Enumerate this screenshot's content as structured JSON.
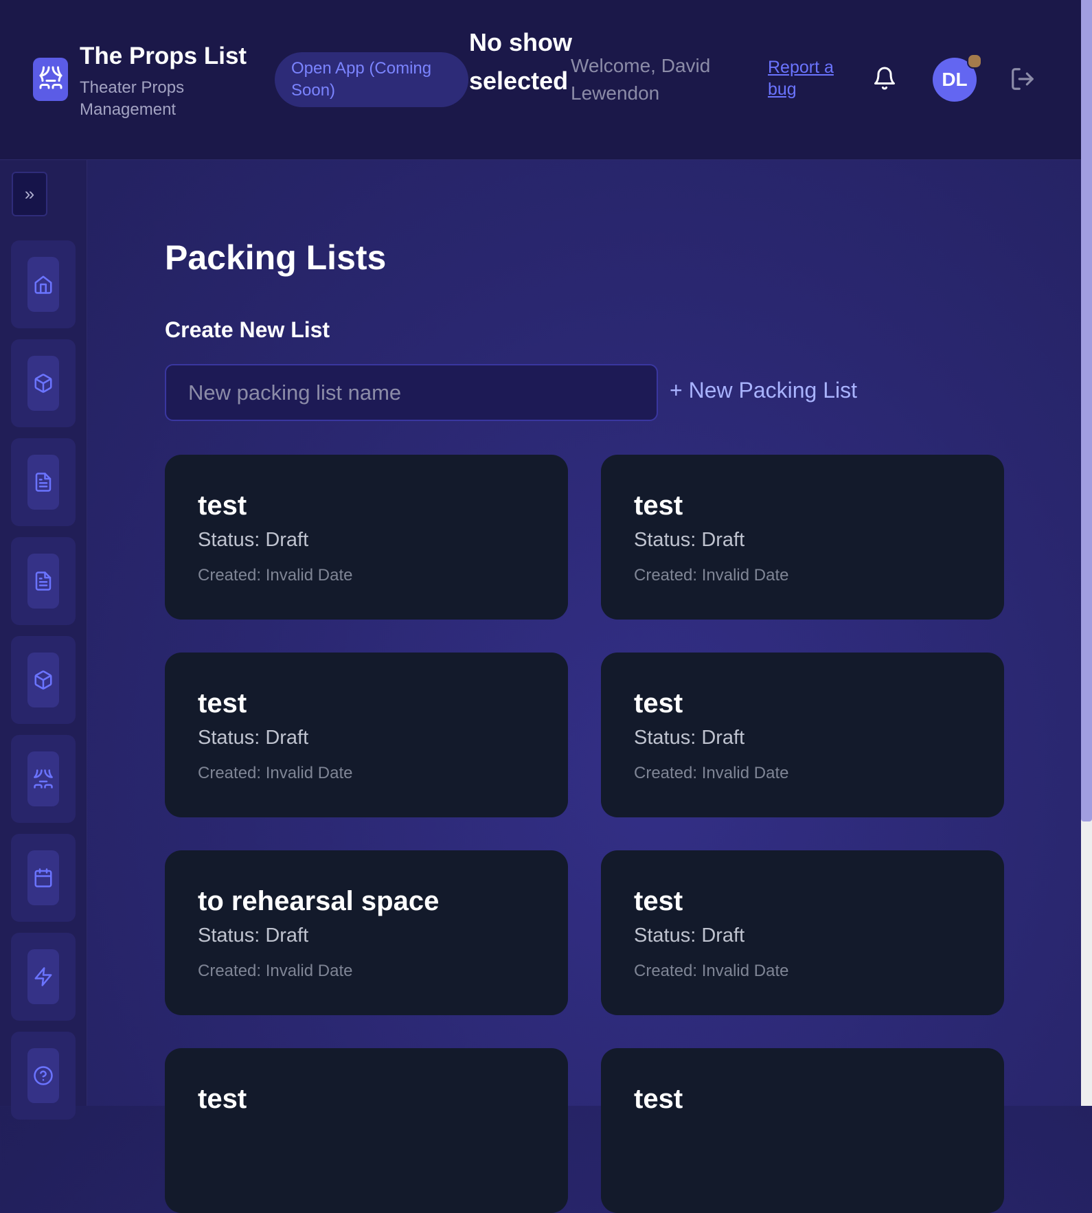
{
  "header": {
    "app_title": "The Props List",
    "app_subtitle": "Theater Props Management",
    "open_app_label": "Open App (Coming Soon)",
    "show_status": "No show selected",
    "welcome_text": "Welcome, David Lewendon",
    "report_bug_label": "Report a bug",
    "avatar_initials": "DL",
    "icons": [
      "theater-masks-icon",
      "bell-icon",
      "logout-icon"
    ]
  },
  "sidebar": {
    "collapse_label": "»",
    "items": [
      {
        "icon": "home-icon"
      },
      {
        "icon": "box-icon"
      },
      {
        "icon": "document-icon"
      },
      {
        "icon": "document-icon"
      },
      {
        "icon": "box-icon"
      },
      {
        "icon": "theater-masks-icon"
      },
      {
        "icon": "calendar-icon"
      },
      {
        "icon": "lightning-icon"
      },
      {
        "icon": "help-icon"
      }
    ]
  },
  "main": {
    "page_title": "Packing Lists",
    "create_section_title": "Create New List",
    "new_list_placeholder": "New packing list name",
    "new_list_button": "+ New Packing List",
    "lists": [
      {
        "name": "test",
        "status": "Status: Draft",
        "created": "Created: Invalid Date"
      },
      {
        "name": "test",
        "status": "Status: Draft",
        "created": "Created: Invalid Date"
      },
      {
        "name": "test",
        "status": "Status: Draft",
        "created": "Created: Invalid Date"
      },
      {
        "name": "test",
        "status": "Status: Draft",
        "created": "Created: Invalid Date"
      },
      {
        "name": "to rehearsal space",
        "status": "Status: Draft",
        "created": "Created: Invalid Date"
      },
      {
        "name": "test",
        "status": "Status: Draft",
        "created": "Created: Invalid Date"
      },
      {
        "name": "test",
        "status": "",
        "created": ""
      },
      {
        "name": "test",
        "status": "",
        "created": ""
      }
    ]
  },
  "colors": {
    "accent": "#6366f1",
    "header_bg": "#1b1849",
    "card_bg": "#131a2b",
    "link": "#6b74ff"
  }
}
